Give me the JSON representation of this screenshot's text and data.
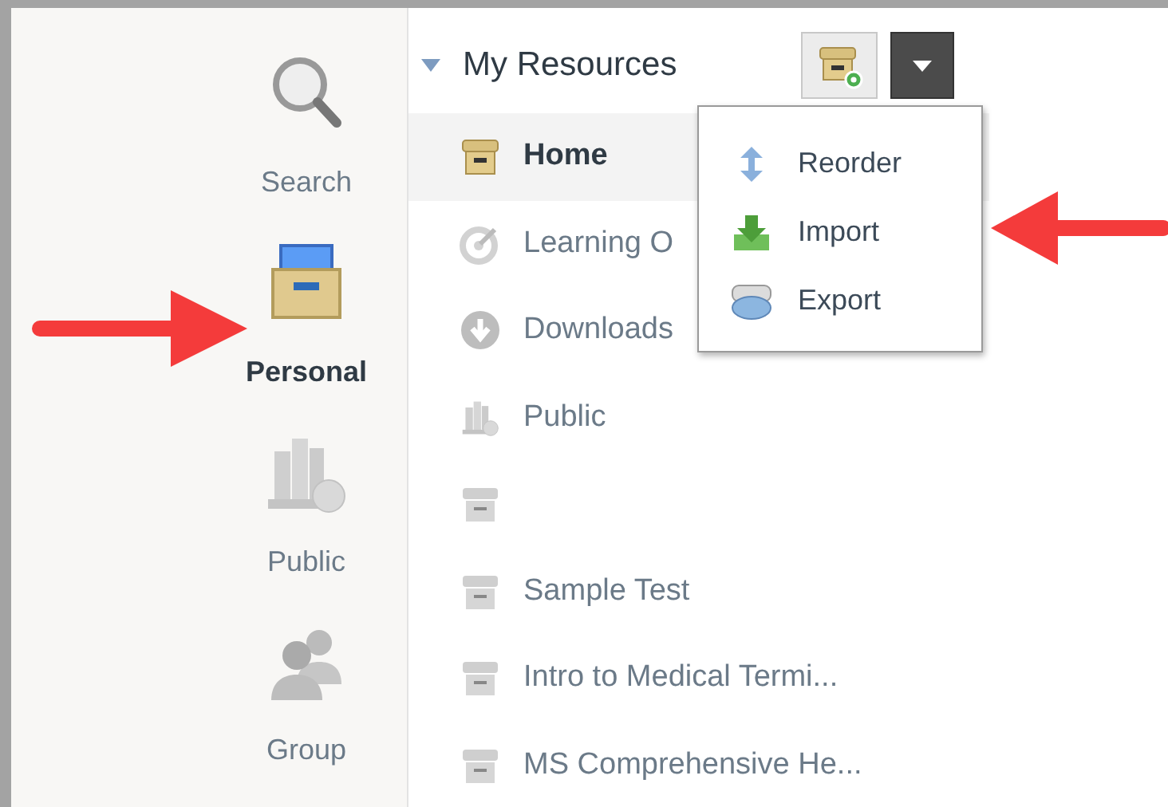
{
  "sidebar": {
    "items": [
      {
        "label": "Search",
        "kind": "search",
        "selected": false
      },
      {
        "label": "Personal",
        "kind": "personal",
        "selected": true
      },
      {
        "label": "Public",
        "kind": "library",
        "selected": false
      },
      {
        "label": "Group",
        "kind": "group",
        "selected": false
      }
    ]
  },
  "resources": {
    "title": "My Resources",
    "expanded": true,
    "items": [
      {
        "label": "Home",
        "kind": "box",
        "selected": true
      },
      {
        "label": "Learning O",
        "kind": "target",
        "selected": false
      },
      {
        "label": "Downloads",
        "kind": "download",
        "selected": false
      },
      {
        "label": "Public",
        "kind": "library",
        "selected": false
      },
      {
        "kind": "greybox",
        "selected": false
      },
      {
        "label": "Sample Test",
        "kind": "greybox",
        "selected": false
      },
      {
        "label": "Intro to Medical Termi...",
        "kind": "greybox",
        "selected": false
      },
      {
        "label": "MS Comprehensive He...",
        "kind": "greybox",
        "selected": false
      }
    ]
  },
  "menu": {
    "items": [
      {
        "label": "Reorder",
        "kind": "reorder"
      },
      {
        "label": "Import",
        "kind": "import"
      },
      {
        "label": "Export",
        "kind": "export"
      }
    ]
  }
}
